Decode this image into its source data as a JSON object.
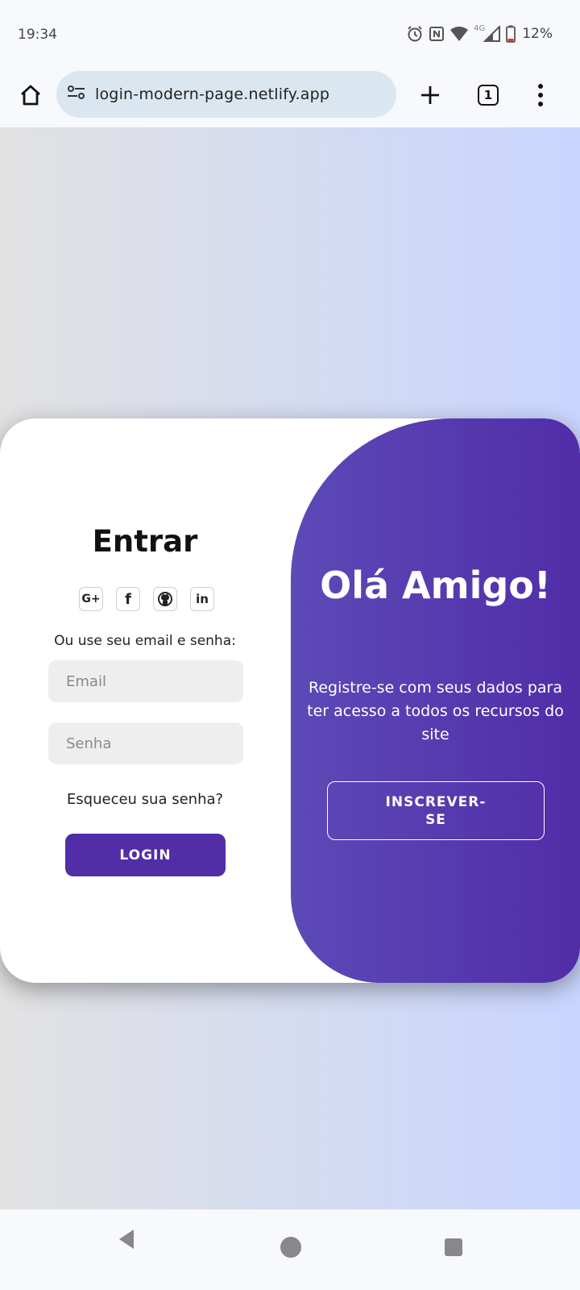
{
  "status_bar": {
    "time": "19:34",
    "battery": "12%",
    "network": "4G",
    "icons": [
      "alarm-icon",
      "nfc-icon",
      "wifi-icon",
      "signal-icon",
      "battery-icon"
    ]
  },
  "browser": {
    "url": "login-modern-page.netlify.app",
    "tab_count": "1",
    "icons": [
      "home-icon",
      "site-settings-icon",
      "new-tab-icon",
      "tabs-icon",
      "more-menu-icon"
    ]
  },
  "login": {
    "title": "Entrar",
    "social": [
      {
        "name": "google-plus",
        "label": "G+"
      },
      {
        "name": "facebook",
        "label": "f"
      },
      {
        "name": "github",
        "label": ""
      },
      {
        "name": "linkedin",
        "label": "in"
      }
    ],
    "or_text": "Ou use seu email e senha:",
    "email_placeholder": "Email",
    "password_placeholder": "Senha",
    "forgot": "Esqueceu sua senha?",
    "login_button": "LOGIN"
  },
  "toggle": {
    "title": "Olá Amigo!",
    "text": "Registre-se com seus dados para ter acesso a todos os recursos do site",
    "signup_button": "INSCREVER-SE"
  },
  "colors": {
    "accent": "#512da8",
    "field_bg": "#eeeeee",
    "gradient_start": "#e2e2e2",
    "gradient_end": "#c8d5fe"
  }
}
